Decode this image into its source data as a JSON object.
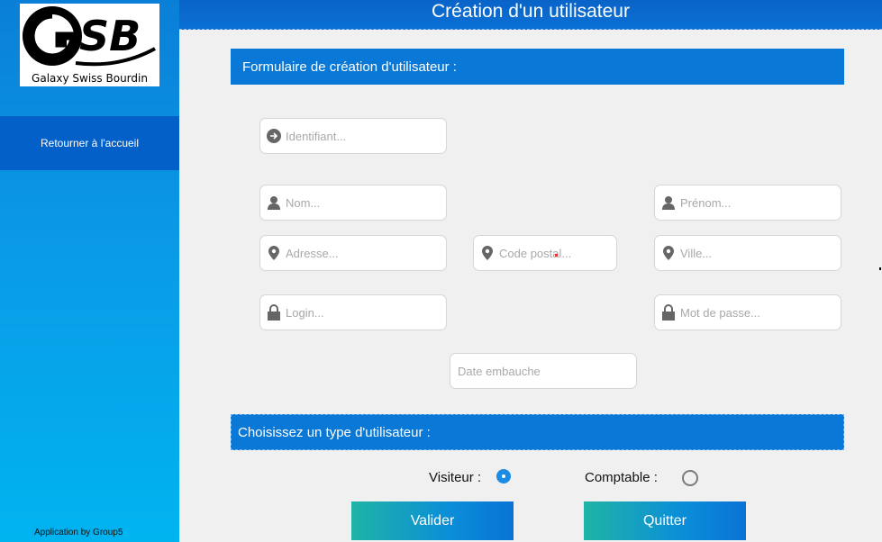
{
  "sidebar": {
    "logo_text": "GSB",
    "logo_caption": "Galaxy Swiss Bourdin",
    "home_button": "Retourner à l'accueil",
    "credit": "Application by Group5"
  },
  "header": {
    "title": "Création d'un utilisateur"
  },
  "form": {
    "section_title": "Formulaire de création d'utilisateur :",
    "fields": {
      "identifiant": "Identifiant...",
      "nom": "Nom...",
      "prenom": "Prénom...",
      "adresse": "Adresse...",
      "code_postal": "Code postal...",
      "ville": "Ville...",
      "login": "Login...",
      "mot_de_passe": "Mot de passe...",
      "date_embauche": "Date embauche"
    }
  },
  "user_type": {
    "section_title": "Choisissez un type d'utilisateur :",
    "options": [
      {
        "label": "Visiteur :",
        "selected": true
      },
      {
        "label": "Comptable :",
        "selected": false
      }
    ]
  },
  "actions": {
    "validate": "Valider",
    "quit": "Quitter"
  },
  "colors": {
    "accent": "#0a78d6",
    "radio_selected": "#1a8ce6",
    "sidebar_active": "#0260c8"
  }
}
